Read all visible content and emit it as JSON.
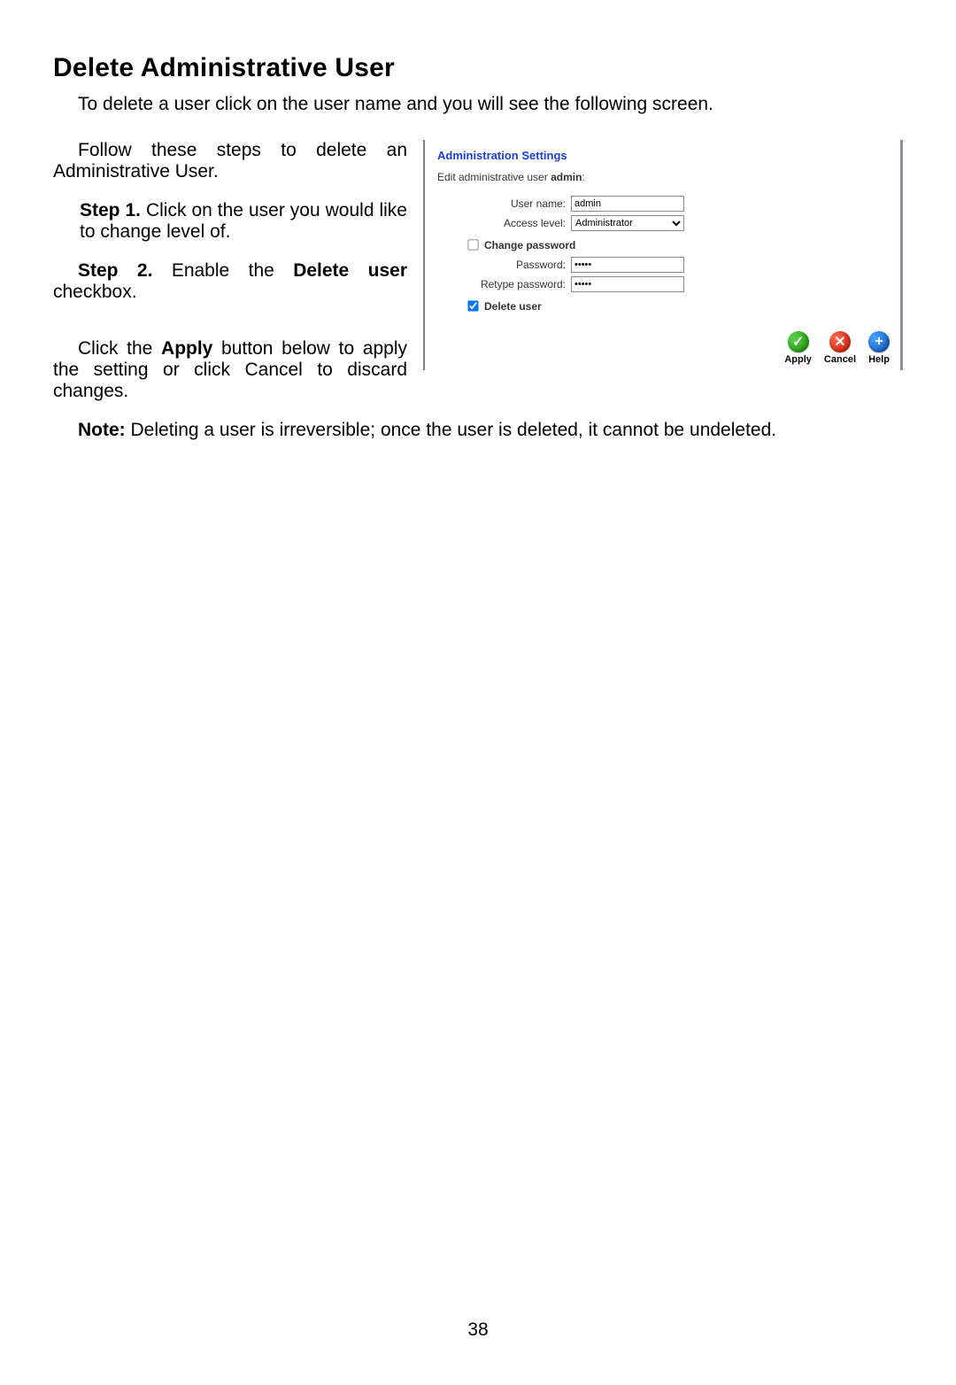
{
  "heading": "Delete Administrative User",
  "intro": "To delete a user click on the user name and you will see the following screen.",
  "follow": "Follow these steps to delete an Administrative User.",
  "step1_bold": "Step 1.",
  "step1_rest": " Click on the user you would like to change level of.",
  "step2_bold": "Step 2.",
  "step2_mid": " Enable the ",
  "step2_bold2": "Delete user",
  "step2_rest": " checkbox.",
  "apply_para_pre": "Click the ",
  "apply_bold": "Apply",
  "apply_para_post": " button below to apply the setting or click Cancel to discard changes.",
  "note_bold": "Note:",
  "note_rest": " Deleting a user is irreversible; once the user is deleted, it cannot be undeleted.",
  "shot": {
    "title": "Administration Settings",
    "sub_pre": "Edit administrative user ",
    "sub_bold": "admin",
    "sub_post": ":",
    "labels": {
      "username": "User name:",
      "access": "Access level:",
      "change_pw": "Change password",
      "password": "Password:",
      "retype": "Retype password:",
      "delete_user": "Delete user"
    },
    "values": {
      "username": "admin",
      "access": "Administrator",
      "password": "•••••",
      "retype": "•••••",
      "change_pw_checked": false,
      "delete_user_checked": true
    },
    "actions": {
      "apply": "Apply",
      "cancel": "Cancel",
      "help": "Help"
    },
    "icons": {
      "apply_glyph": "✓",
      "cancel_glyph": "✕",
      "help_glyph": "+"
    }
  },
  "page_number": "38"
}
